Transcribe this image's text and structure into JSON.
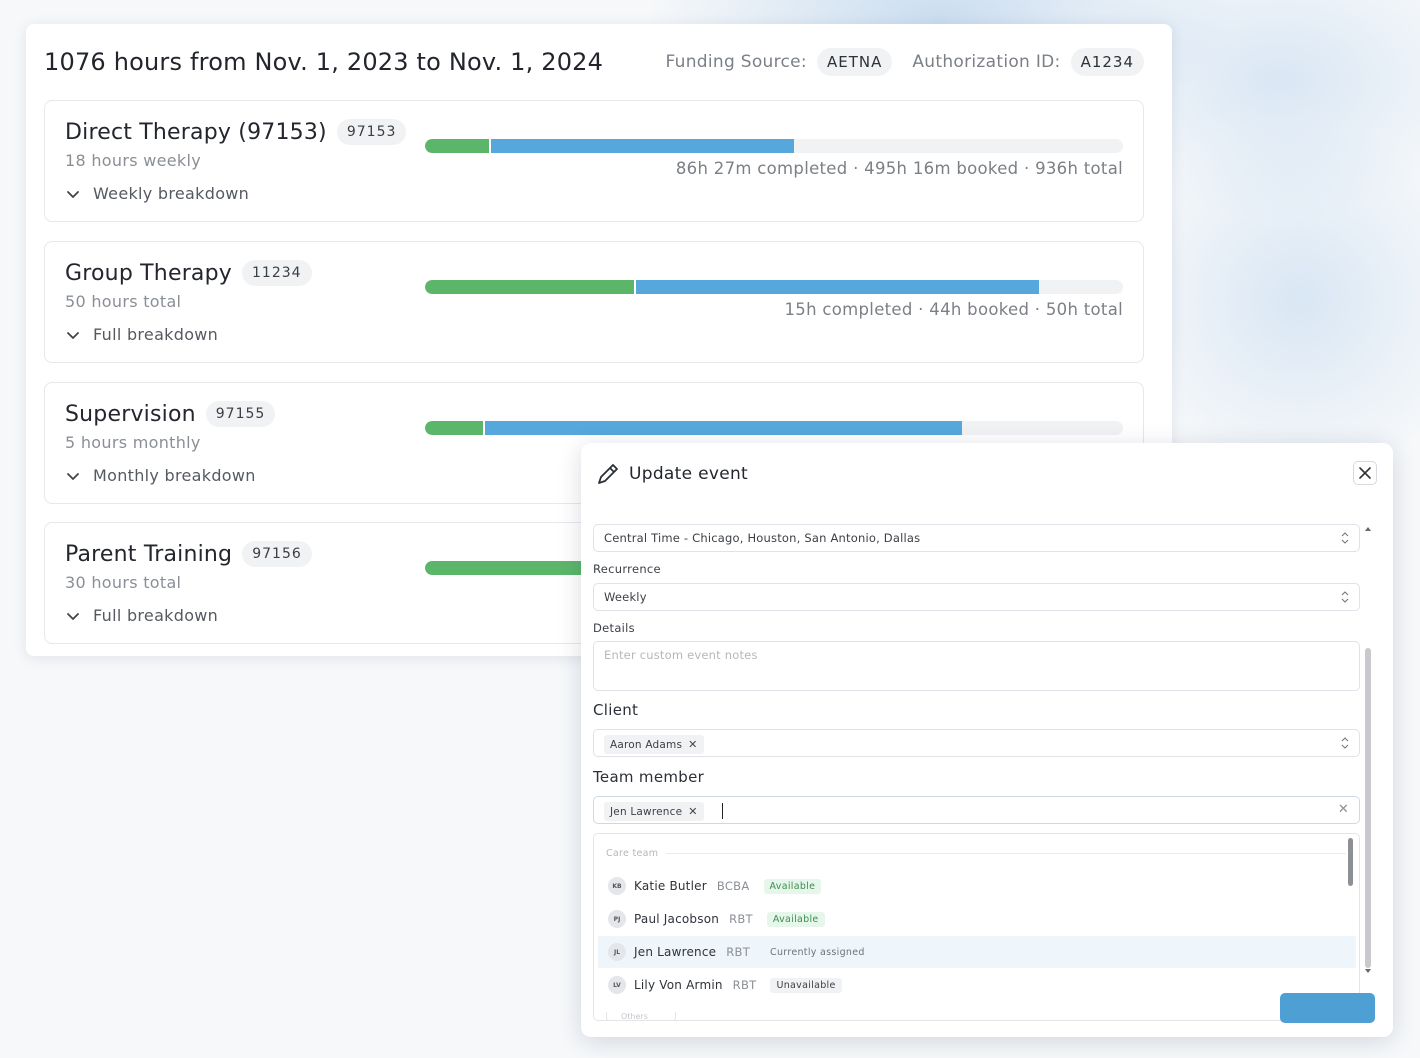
{
  "header": {
    "title": "1076 hours from Nov. 1, 2023 to Nov. 1, 2024",
    "funding_label": "Funding Source:",
    "funding_value": "AETNA",
    "auth_label": "Authorization ID:",
    "auth_value": "A1234"
  },
  "services": [
    {
      "name": "Direct Therapy (97153)",
      "code": "97153",
      "subtitle": "18 hours weekly",
      "toggle": "Weekly breakdown",
      "completed_fraction": 0.092,
      "booked_fraction": 0.529,
      "stats": "86h 27m completed · 495h 16m booked · 936h total"
    },
    {
      "name": "Group Therapy",
      "code": "11234",
      "subtitle": "50 hours total",
      "toggle": "Full breakdown",
      "completed_fraction": 0.3,
      "booked_fraction": 0.88,
      "stats": "15h completed · 44h booked · 50h total"
    },
    {
      "name": "Supervision",
      "code": "97155",
      "subtitle": "5 hours monthly",
      "toggle": "Monthly breakdown",
      "completed_fraction": 0.083,
      "booked_fraction": 0.77,
      "stats": ""
    },
    {
      "name": "Parent Training",
      "code": "97156",
      "subtitle": "30 hours total",
      "toggle": "Full breakdown",
      "completed_fraction": 0.3,
      "booked_fraction": 0.3,
      "stats": ""
    }
  ],
  "modal": {
    "title": "Update event",
    "timezone_value": "Central Time - Chicago, Houston, San Antonio, Dallas",
    "recurrence_label": "Recurrence",
    "recurrence_value": "Weekly",
    "details_label": "Details",
    "details_placeholder": "Enter custom event notes",
    "client_label": "Client",
    "client_tag": "Aaron Adams",
    "team_label": "Team member",
    "team_tag": "Jen Lawrence",
    "dropdown": {
      "group_label": "Care team",
      "people": [
        {
          "initials": "KB",
          "name": "Katie Butler",
          "role": "BCBA",
          "status": "Available",
          "status_kind": "available"
        },
        {
          "initials": "PJ",
          "name": "Paul Jacobson",
          "role": "RBT",
          "status": "Available",
          "status_kind": "available"
        },
        {
          "initials": "JL",
          "name": "Jen Lawrence",
          "role": "RBT",
          "status": "Currently assigned",
          "status_kind": "assigned"
        },
        {
          "initials": "LV",
          "name": "Lily Von Armin",
          "role": "RBT",
          "status": "Unavailable",
          "status_kind": "unavailable"
        }
      ],
      "next_group_label": "Others"
    }
  },
  "colors": {
    "completed": "#5cb66a",
    "booked": "#56a8dc",
    "track": "#f1f2f4"
  },
  "icons": {
    "edit": "pencil-icon",
    "close": "close-icon",
    "expand": "chevron-down-icon",
    "select": "updown-icon",
    "remove": "x-icon"
  }
}
